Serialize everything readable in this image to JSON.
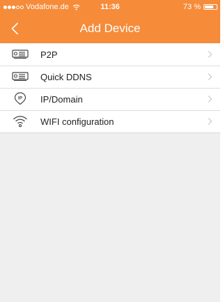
{
  "colors": {
    "accent": "#f68b3a",
    "background": "#efefef",
    "list_background": "#ffffff",
    "text": "#222222",
    "chevron": "#c7c7cc",
    "icon": "#444444"
  },
  "status_bar": {
    "signal_strength": "3 of 5",
    "carrier": "Vodafone.de",
    "time": "11:36",
    "battery_percent": "73 %",
    "battery_level": 0.73,
    "wifi_icon": "wifi-icon"
  },
  "nav": {
    "title": "Add Device",
    "back_icon": "chevron-left-icon"
  },
  "menu": {
    "items": [
      {
        "label": "P2P",
        "icon": "device-box-icon"
      },
      {
        "label": "Quick DDNS",
        "icon": "device-box-icon"
      },
      {
        "label": "IP/Domain",
        "icon": "ip-pin-icon"
      },
      {
        "label": "WIFI configuration",
        "icon": "wifi-icon"
      }
    ],
    "chevron_icon": "chevron-right-icon"
  }
}
